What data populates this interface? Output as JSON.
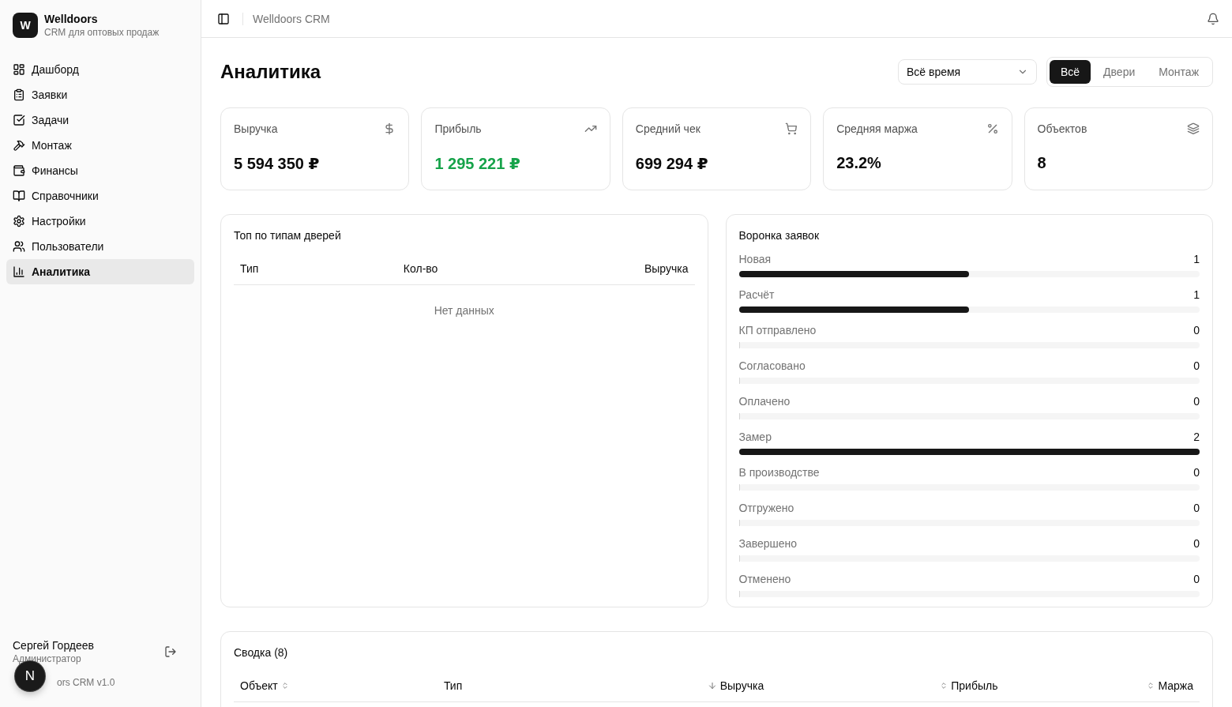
{
  "brand": {
    "logo": "W",
    "name": "Welldoors",
    "subtitle": "CRM для оптовых продаж"
  },
  "sidebar": {
    "items": [
      {
        "label": "Дашборд",
        "selected": false
      },
      {
        "label": "Заявки",
        "selected": false
      },
      {
        "label": "Задачи",
        "selected": false
      },
      {
        "label": "Монтаж",
        "selected": false
      },
      {
        "label": "Финансы",
        "selected": false
      },
      {
        "label": "Справочники",
        "selected": false
      },
      {
        "label": "Настройки",
        "selected": false
      },
      {
        "label": "Пользователи",
        "selected": false
      },
      {
        "label": "Аналитика",
        "selected": true
      }
    ],
    "user": {
      "name": "Сергей Гордеев",
      "role": "Администратор"
    },
    "version": "ors CRM v1.0"
  },
  "dev_badge": "N",
  "header": {
    "breadcrumb": "Welldoors CRM"
  },
  "page": {
    "title": "Аналитика",
    "period": "Всё время",
    "segments": [
      {
        "label": "Всё",
        "selected": true
      },
      {
        "label": "Двери",
        "selected": false
      },
      {
        "label": "Монтаж",
        "selected": false
      }
    ]
  },
  "stats": [
    {
      "label": "Выручка",
      "value": "5 594 350 ₽",
      "positive": false
    },
    {
      "label": "Прибыль",
      "value": "1 295 221 ₽",
      "positive": true
    },
    {
      "label": "Средний чек",
      "value": "699 294 ₽",
      "positive": false
    },
    {
      "label": "Средняя маржа",
      "value": "23.2%",
      "positive": false
    },
    {
      "label": "Объектов",
      "value": "8",
      "positive": false
    }
  ],
  "door_types": {
    "title": "Топ по типам дверей",
    "columns": [
      "Тип",
      "Кол-во",
      "Выручка"
    ],
    "empty": "Нет данных"
  },
  "funnel": {
    "title": "Воронка заявок",
    "stages": [
      {
        "label": "Новая",
        "count": "1",
        "level": 0.5
      },
      {
        "label": "Расчёт",
        "count": "1",
        "level": 0.5
      },
      {
        "label": "КП отправлено",
        "count": "0",
        "level": 0
      },
      {
        "label": "Согласовано",
        "count": "0",
        "level": 0
      },
      {
        "label": "Оплачено",
        "count": "0",
        "level": 0
      },
      {
        "label": "Замер",
        "count": "2",
        "level": 1
      },
      {
        "label": "В производстве",
        "count": "0",
        "level": 0
      },
      {
        "label": "Отгружено",
        "count": "0",
        "level": 0
      },
      {
        "label": "Завершено",
        "count": "0",
        "level": 0
      },
      {
        "label": "Отменено",
        "count": "0",
        "level": 0
      }
    ]
  },
  "summary": {
    "title": "Сводка (8)",
    "columns": [
      {
        "label": "Объект",
        "kind": "sortable"
      },
      {
        "label": "Тип",
        "kind": "plain"
      },
      {
        "label": "Выручка",
        "kind": "sorted"
      },
      {
        "label": "Прибыль",
        "kind": "sortable"
      },
      {
        "label": "Маржа",
        "kind": "sortable"
      }
    ]
  }
}
